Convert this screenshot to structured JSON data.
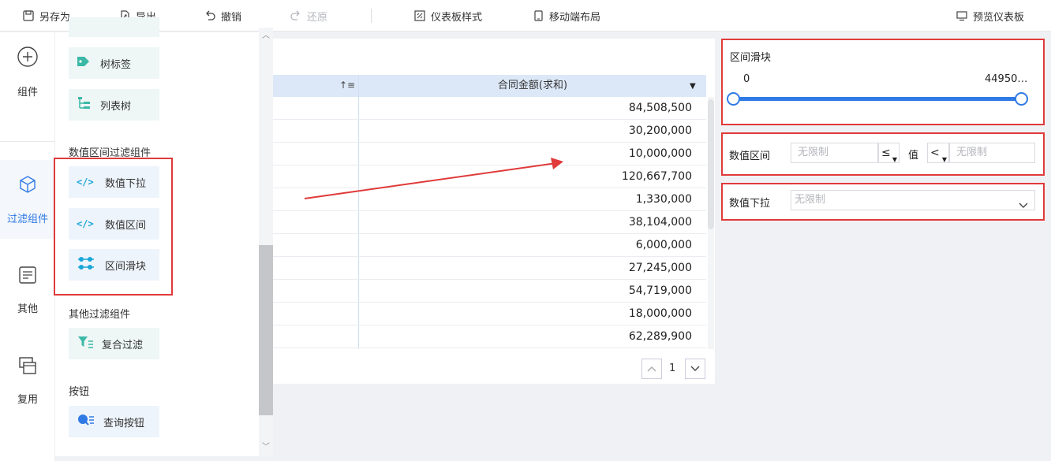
{
  "toolbar": {
    "save_as": "另存为",
    "export": "导出",
    "undo": "撤销",
    "redo": "还原",
    "dashboard_style": "仪表板样式",
    "mobile_layout": "移动端布局",
    "preview": "预览仪表板"
  },
  "rail": {
    "items": [
      {
        "label": "组件",
        "icon": "plus-circle-icon"
      },
      {
        "label": "过滤组件",
        "icon": "cube-icon"
      },
      {
        "label": "其他",
        "icon": "document-icon"
      },
      {
        "label": "复用",
        "icon": "copy-icon"
      }
    ]
  },
  "panel": {
    "items_top": [
      {
        "label": "树标签",
        "icon": "tag-icon"
      },
      {
        "label": "列表树",
        "icon": "tree-list-icon"
      }
    ],
    "numeric_section": "数值区间过滤组件",
    "numeric_items": [
      {
        "label": "数值下拉",
        "icon": "code-icon"
      },
      {
        "label": "数值区间",
        "icon": "code-icon"
      },
      {
        "label": "区间滑块",
        "icon": "slider-icon"
      }
    ],
    "other_section": "其他过滤组件",
    "other_items": [
      {
        "label": "复合过滤",
        "icon": "funnel-icon"
      }
    ],
    "button_section": "按钮",
    "button_items": [
      {
        "label": "查询按钮",
        "icon": "search-list-icon"
      }
    ]
  },
  "table": {
    "column_header": "合同金额(求和)",
    "sort_icon": "sort-ascending-icon",
    "rows": [
      "84,508,500",
      "30,200,000",
      "10,000,000",
      "120,667,700",
      "1,330,000",
      "38,104,000",
      "6,000,000",
      "27,245,000",
      "54,719,000",
      "18,000,000",
      "62,289,900"
    ],
    "page": "1"
  },
  "slider_widget": {
    "title": "区间滑块",
    "min_label": "0",
    "max_label": "44950…"
  },
  "range_widget": {
    "title": "数值区间",
    "min_placeholder": "无限制",
    "min_op": "≤",
    "value_label": "值",
    "max_op": "<",
    "max_placeholder": "无限制"
  },
  "dropdown_widget": {
    "title": "数值下拉",
    "placeholder": "无限制"
  },
  "colors": {
    "accent": "#2f7ae5",
    "highlight_box": "#e03a3a",
    "table_header": "#dce8f8"
  }
}
